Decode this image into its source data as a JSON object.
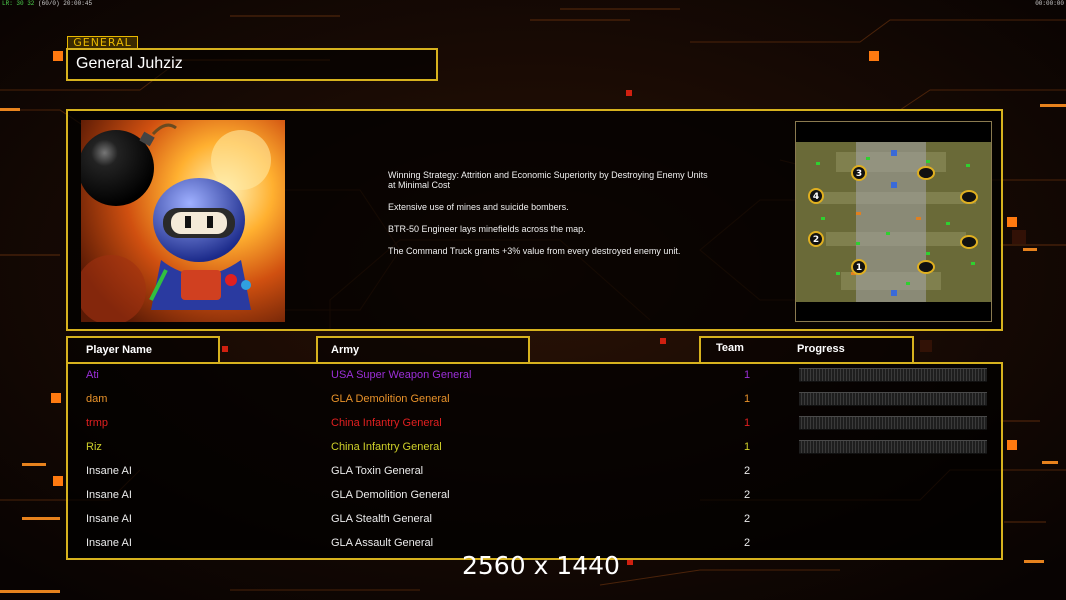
{
  "hud": {
    "fps_green": "LR: 30 32",
    "fps_rest": "(60/0)",
    "clock_left": "20:00:45",
    "clock_right": "00:00:00"
  },
  "general": {
    "tag": "GENERAL",
    "name": "General Juhziz"
  },
  "strategy": {
    "lines": [
      "Winning Strategy: Attrition and Economic Superiority by Destroying Enemy Units at Minimal Cost",
      "Extensive use of mines and suicide bombers.",
      "BTR-50 Engineer lays minefields across the map.",
      "The Command Truck grants +3% value from every destroyed enemy unit."
    ]
  },
  "minimap": {
    "start_markers": [
      "3",
      "4",
      "2",
      "1"
    ]
  },
  "table": {
    "headers": {
      "player": "Player Name",
      "army": "Army",
      "team": "Team",
      "progress": "Progress"
    },
    "rows": [
      {
        "name": "Ati",
        "army": "USA Super Weapon General",
        "team": "1",
        "color": "#9b2fd8",
        "progress": 0
      },
      {
        "name": "dam",
        "army": "GLA Demolition General",
        "team": "1",
        "color": "#e8922a",
        "progress": 0
      },
      {
        "name": "trmp",
        "army": "China Infantry General",
        "team": "1",
        "color": "#e02020",
        "progress": 0
      },
      {
        "name": "Riz",
        "army": "China Infantry General",
        "team": "1",
        "color": "#cfd02a",
        "progress": 0
      },
      {
        "name": "Insane AI",
        "army": "GLA Toxin General",
        "team": "2",
        "color": "#ececec",
        "progress": null
      },
      {
        "name": "Insane AI",
        "army": "GLA Demolition General",
        "team": "2",
        "color": "#ececec",
        "progress": null
      },
      {
        "name": "Insane AI",
        "army": "GLA Stealth General",
        "team": "2",
        "color": "#ececec",
        "progress": null
      },
      {
        "name": "Insane AI",
        "army": "GLA Assault General",
        "team": "2",
        "color": "#ececec",
        "progress": null
      }
    ]
  },
  "resolution_label": "2560 x 1440",
  "colors": {
    "accent_gold": "#d7b21e",
    "accent_orange": "#ff8c1a"
  }
}
